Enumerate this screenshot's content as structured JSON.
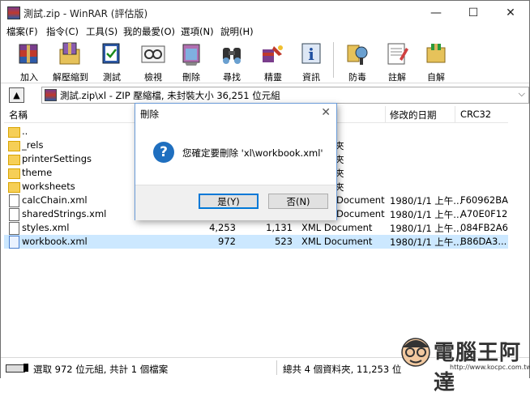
{
  "window": {
    "title": "測試.zip - WinRAR (評估版)",
    "minimize": "—",
    "maximize": "☐",
    "close": "✕"
  },
  "menu": [
    "檔案(F)",
    "指令(C)",
    "工具(S)",
    "我的最愛(O)",
    "選項(N)",
    "說明(H)"
  ],
  "toolbar": [
    {
      "label": "加入",
      "icon": "add-archive-icon"
    },
    {
      "label": "解壓縮到",
      "icon": "extract-to-icon"
    },
    {
      "label": "測試",
      "icon": "test-icon"
    },
    {
      "label": "檢視",
      "icon": "view-icon"
    },
    {
      "label": "刪除",
      "icon": "delete-icon"
    },
    {
      "label": "尋找",
      "icon": "find-icon"
    },
    {
      "label": "精靈",
      "icon": "wizard-icon"
    },
    {
      "label": "資訊",
      "icon": "info-icon"
    },
    {
      "label": "防毒",
      "icon": "virus-scan-icon"
    },
    {
      "label": "註解",
      "icon": "comment-icon"
    },
    {
      "label": "自解",
      "icon": "sfx-icon"
    }
  ],
  "address": {
    "path": "測試.zip\\xl - ZIP 壓縮檔, 未封裝大小 36,251 位元組"
  },
  "columns": {
    "name": "名稱",
    "modified": "修改的日期",
    "crc": "CRC32"
  },
  "files": [
    {
      "name": "..",
      "type": "folder",
      "size": "",
      "packed": "",
      "kind": "",
      "modified": "",
      "crc": ""
    },
    {
      "name": "_rels",
      "type": "folder",
      "size": "",
      "packed": "",
      "kind": "夾",
      "modified": "",
      "crc": ""
    },
    {
      "name": "printerSettings",
      "type": "folder",
      "size": "",
      "packed": "",
      "kind": "夾",
      "modified": "",
      "crc": ""
    },
    {
      "name": "theme",
      "type": "folder",
      "size": "",
      "packed": "",
      "kind": "夾",
      "modified": "",
      "crc": ""
    },
    {
      "name": "worksheets",
      "type": "folder",
      "size": "",
      "packed": "",
      "kind": "夾",
      "modified": "",
      "crc": ""
    },
    {
      "name": "calcChain.xml",
      "type": "doc",
      "size": "",
      "packed": "",
      "kind": "Document",
      "modified": "1980/1/1 上午...",
      "crc": "F60962BA"
    },
    {
      "name": "sharedStrings.xml",
      "type": "doc",
      "size": "",
      "packed": "",
      "kind": "Document",
      "modified": "1980/1/1 上午...",
      "crc": "A70E0F12"
    },
    {
      "name": "styles.xml",
      "type": "doc",
      "size": "4,253",
      "packed": "1,131",
      "kind": "XML Document",
      "modified": "1980/1/1 上午...",
      "crc": "084FB2A6"
    },
    {
      "name": "workbook.xml",
      "type": "doc-blue",
      "size": "972",
      "packed": "523",
      "kind": "XML Document",
      "modified": "1980/1/1 上午...",
      "crc": "B86DA3..."
    }
  ],
  "status": {
    "left": "選取 972 位元組, 共計 1 個檔案",
    "right": "總共 4 個資料夾, 11,253 位"
  },
  "dialog": {
    "title": "刪除",
    "close": "✕",
    "icon_glyph": "?",
    "message": "您確定要刪除 'xl\\workbook.xml'",
    "yes": "是(Y)",
    "no": "否(N)"
  },
  "watermark": {
    "text": "電腦王阿達",
    "url": "http://www.kocpc.com.tw"
  }
}
